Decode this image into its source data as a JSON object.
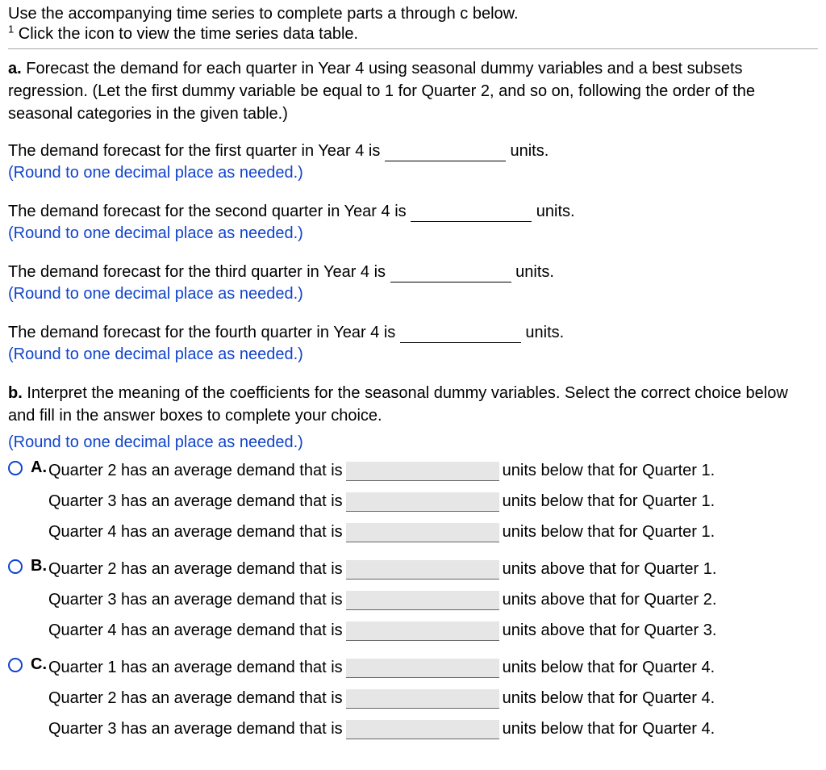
{
  "intro": {
    "line1": "Use the accompanying time series to complete parts a through c below.",
    "sup": "1",
    "line2": " Click the icon to view the time series data table."
  },
  "partA": {
    "label": "a.",
    "text": " Forecast the demand for each quarter in Year 4 using seasonal dummy variables and a best subsets regression. (Let the first dummy variable be equal to 1 for Quarter 2, and so on, following the order of the seasonal categories in the given table.)",
    "blanks": [
      {
        "pre": "The demand forecast for the first quarter in Year 4 is ",
        "post": " units."
      },
      {
        "pre": "The demand forecast for the second quarter in Year 4 is ",
        "post": " units."
      },
      {
        "pre": "The demand forecast for the third quarter in Year 4 is ",
        "post": " units."
      },
      {
        "pre": "The demand forecast for the fourth quarter in Year 4 is ",
        "post": " units."
      }
    ],
    "hint": "(Round to one decimal place as needed.)"
  },
  "partB": {
    "label": "b.",
    "intro": " Interpret the meaning of the coefficients for the seasonal dummy variables. Select the correct choice below and fill in the answer boxes to complete your choice.",
    "hint": "(Round to one decimal place as needed.)",
    "choices": [
      {
        "letter": "A.",
        "lines": [
          {
            "pre": "Quarter 2 has an average demand that is ",
            "post": " units below that for Quarter 1."
          },
          {
            "pre": "Quarter 3 has an average demand that is ",
            "post": " units below that for Quarter 1."
          },
          {
            "pre": "Quarter 4 has an average demand that is ",
            "post": " units below that for Quarter 1."
          }
        ]
      },
      {
        "letter": "B.",
        "lines": [
          {
            "pre": "Quarter 2 has an average demand that is ",
            "post": " units above that for Quarter 1."
          },
          {
            "pre": "Quarter 3 has an average demand that is ",
            "post": " units above that for Quarter 2."
          },
          {
            "pre": "Quarter 4 has an average demand that is ",
            "post": " units above that for Quarter 3."
          }
        ]
      },
      {
        "letter": "C.",
        "lines": [
          {
            "pre": "Quarter 1 has an average demand that is ",
            "post": " units below that for Quarter 4."
          },
          {
            "pre": "Quarter 2 has an average demand that is ",
            "post": " units below that for Quarter 4."
          },
          {
            "pre": "Quarter 3 has an average demand that is ",
            "post": " units below that for Quarter 4."
          }
        ]
      }
    ]
  }
}
